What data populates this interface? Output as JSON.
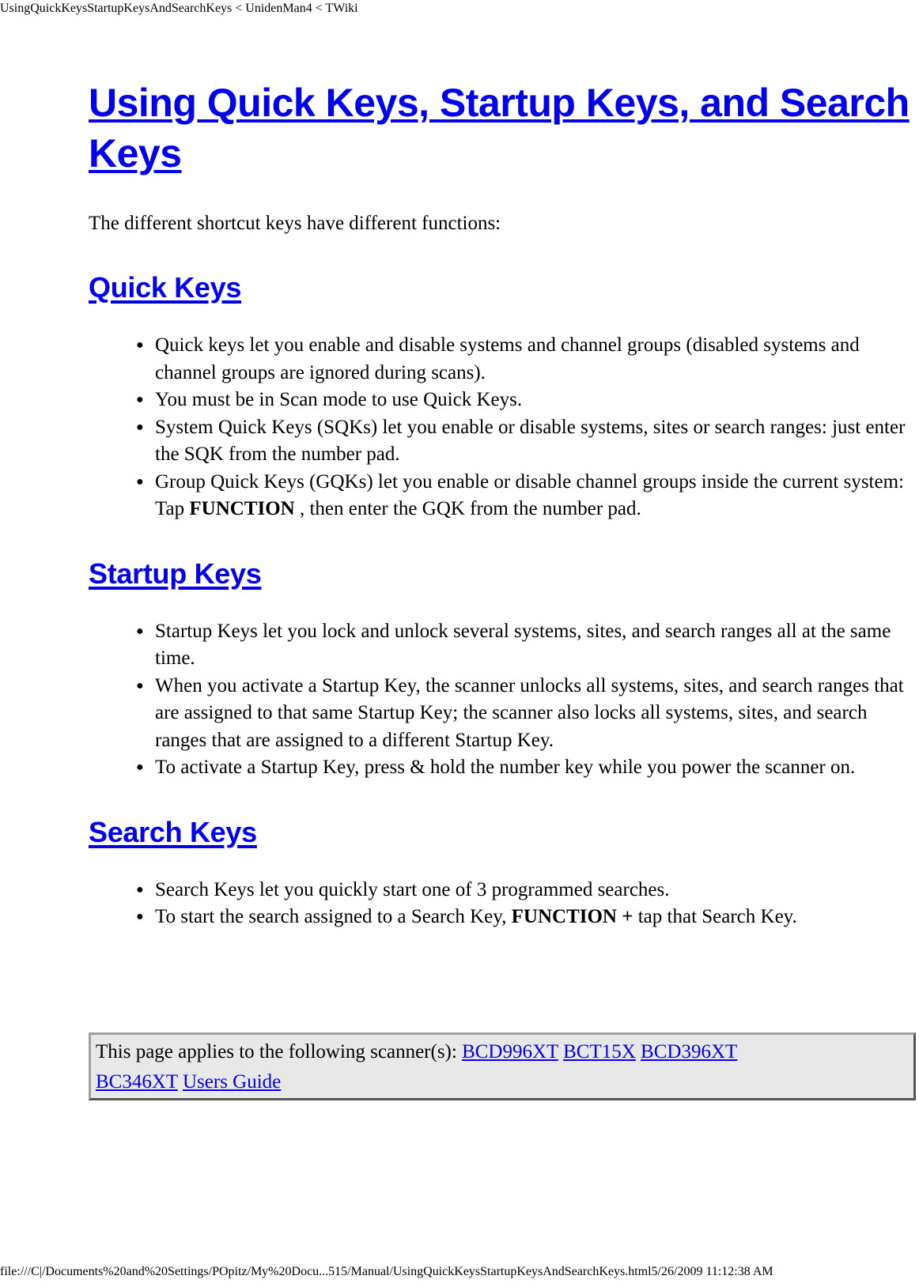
{
  "print_header": {
    "title": "UsingQuickKeysStartupKeysAndSearchKeys < UnidenMan4 < TWiki"
  },
  "page": {
    "title": "Using Quick Keys, Startup Keys, and Search Keys",
    "intro": "The different shortcut keys have different functions:"
  },
  "sections": {
    "quick_keys": {
      "heading": "Quick Keys",
      "items": [
        "Quick keys let you enable and disable systems and channel groups (disabled systems and channel groups are ignored during scans).",
        "You must be in Scan mode to use Quick Keys.",
        "System Quick Keys (SQKs) let you enable or disable systems, sites or search ranges: just enter the SQK from the number pad."
      ],
      "item4": {
        "before": "Group Quick Keys (GQKs) let you enable or disable channel groups inside the current system: Tap ",
        "bold": "FUNCTION",
        "after": " , then enter the GQK from the number pad."
      }
    },
    "startup_keys": {
      "heading": "Startup Keys",
      "items": [
        "Startup Keys let you lock and unlock several systems, sites, and search ranges all at the same time.",
        "When you activate a Startup Key, the scanner unlocks all systems, sites, and search ranges that are assigned to that same Startup Key; the scanner also locks all systems, sites, and search ranges that are assigned to a different Startup Key.",
        "To activate a Startup Key, press & hold the number key while you power the scanner on."
      ]
    },
    "search_keys": {
      "heading": "Search Keys",
      "items": [
        "Search Keys let you quickly start one of 3 programmed searches."
      ],
      "item2": {
        "before": "To start the search assigned to a Search Key, ",
        "bold": "FUNCTION +",
        "after": " tap that Search Key."
      }
    }
  },
  "applies_box": {
    "label": "This page applies to the following scanner(s): ",
    "links": [
      "BCD996XT",
      "BCT15X",
      "BCD396XT",
      "BC346XT",
      "Users Guide"
    ]
  },
  "print_footer": {
    "url_and_time": "file:///C|/Documents%20and%20Settings/POpitz/My%20Docu...515/Manual/UsingQuickKeysStartupKeysAndSearchKeys.html5/26/2009 11:12:38 AM"
  },
  "colors": {
    "link": "#0000ee",
    "box_background": "#e8e8e8",
    "text": "#000000"
  }
}
